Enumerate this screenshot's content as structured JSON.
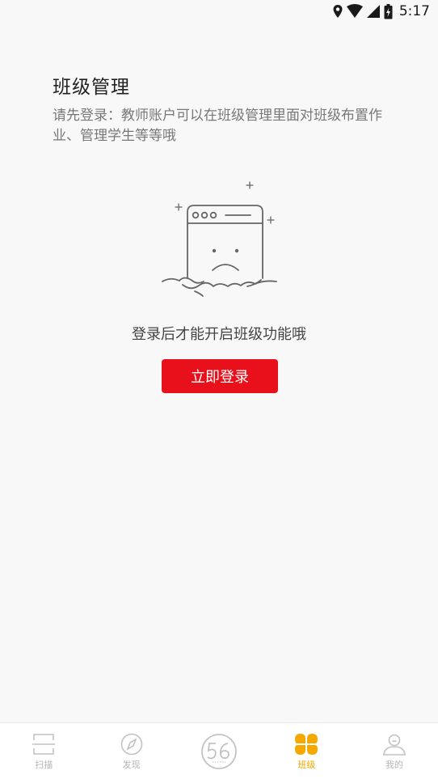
{
  "status_bar": {
    "time": "5:17"
  },
  "page": {
    "title": "班级管理",
    "description": "请先登录：教师账户可以在班级管理里面对班级布置作业、管理学生等等哦"
  },
  "empty_state": {
    "message": "登录后才能开启班级功能哦",
    "login_button": "立即登录"
  },
  "bottom_nav": {
    "items": [
      {
        "label": "扫描",
        "icon": "scan-icon",
        "active": false
      },
      {
        "label": "发现",
        "icon": "compass-icon",
        "active": false
      },
      {
        "label": "",
        "icon": "56-logo-icon",
        "active": false
      },
      {
        "label": "班级",
        "icon": "clover-icon",
        "active": true
      },
      {
        "label": "我的",
        "icon": "person-icon",
        "active": false
      }
    ]
  },
  "colors": {
    "accent": "#e8101a",
    "active_tab": "#f5a800",
    "inactive_tab": "#b5b5b5",
    "background": "#f8f8f9"
  }
}
